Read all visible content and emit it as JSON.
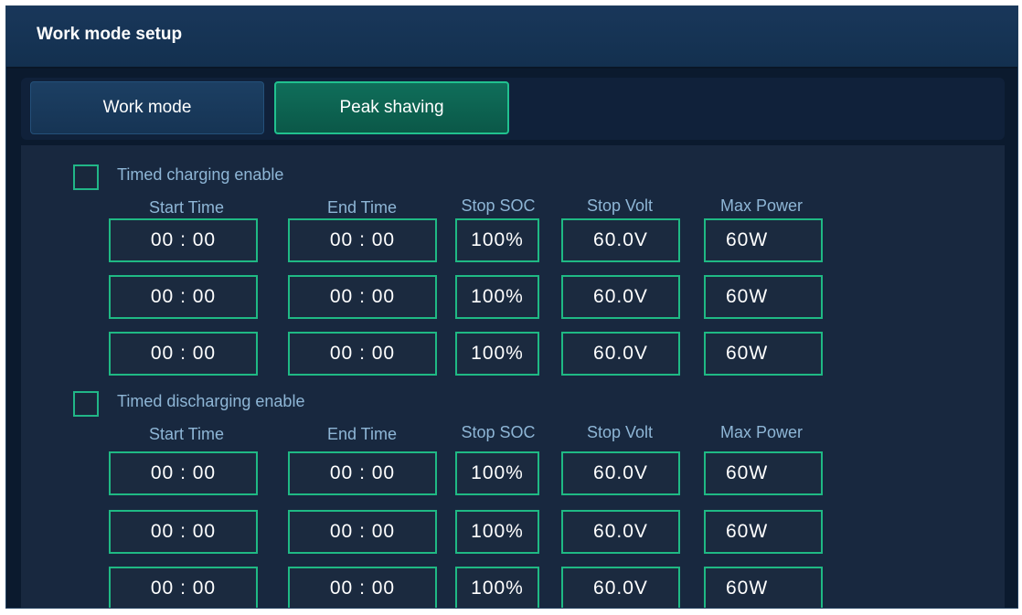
{
  "window": {
    "title": "Work mode setup"
  },
  "tabs": [
    {
      "label": "Work mode",
      "active": false
    },
    {
      "label": "Peak shaving",
      "active": true
    }
  ],
  "headers": [
    "Start Time",
    "End Time",
    "Stop SOC",
    "Stop Volt",
    "Max Power"
  ],
  "charging": {
    "label": "Timed charging enable",
    "checked": false,
    "rows": [
      {
        "start": "00 : 00",
        "end": "00 : 00",
        "soc": "100%",
        "volt": "60.0V",
        "power": "60W"
      },
      {
        "start": "00 : 00",
        "end": "00 : 00",
        "soc": "100%",
        "volt": "60.0V",
        "power": "60W"
      },
      {
        "start": "00 : 00",
        "end": "00 : 00",
        "soc": "100%",
        "volt": "60.0V",
        "power": "60W"
      }
    ]
  },
  "discharging": {
    "label": "Timed discharging enable",
    "checked": false,
    "rows": [
      {
        "start": "00 : 00",
        "end": "00 : 00",
        "soc": "100%",
        "volt": "60.0V",
        "power": "60W"
      },
      {
        "start": "00 : 00",
        "end": "00 : 00",
        "soc": "100%",
        "volt": "60.0V",
        "power": "60W"
      },
      {
        "start": "00 : 00",
        "end": "00 : 00",
        "soc": "100%",
        "volt": "60.0V",
        "power": "60W"
      }
    ]
  },
  "colors": {
    "accent": "#21b687",
    "background": "#0b1a2e",
    "label": "#8eb6d6"
  }
}
